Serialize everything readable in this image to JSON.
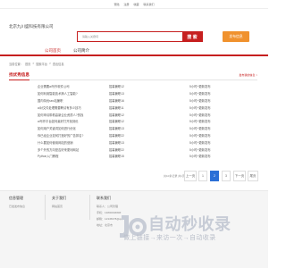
{
  "topbar": {
    "links": [
      "登陆",
      "注册",
      "收藏",
      "联系我们"
    ]
  },
  "header": {
    "brand": "北京九川盛科技有限公司",
    "search_placeholder": "请输入关键词",
    "search_button": "搜 索",
    "publish_button": "发布信息"
  },
  "nav": {
    "items": [
      "公司首页",
      "公司简介"
    ]
  },
  "breadcrumb": [
    "当前位置：",
    "首页",
    ">",
    "搜索平台",
    ">",
    "查出信息"
  ],
  "section": {
    "title": "找优秀信息",
    "more": "发布我的信息 >"
  },
  "list": [
    {
      "title": "企业需要ai写作软件公司",
      "tag": "招募兼职12",
      "time": "5小时+更新发布"
    },
    {
      "title": "如何利用智能技术搞人工智能?",
      "tag": "招募兼职13",
      "time": "5小时+更新发布"
    },
    {
      "title": "国内特优seo站兼职",
      "tag": "招募兼职16",
      "time": "5小时+更新发布"
    },
    {
      "title": "ai对文件处理需要聘请有多少技巧",
      "tag": "招募兼职11",
      "time": "5小时+更新发布"
    },
    {
      "title": "如何申请带着高新企业资质人?的找",
      "tag": "招募兼职12",
      "time": "5小时+更新发布"
    },
    {
      "title": "ai写作平台如何最好打开找到优",
      "tag": "招募兼职12",
      "time": "5小时+更新发布"
    },
    {
      "title": "如何用户关键词如何进行优化",
      "tag": "招募兼职13",
      "time": "5小时+更新发布"
    },
    {
      "title": "你已经企业如何打造好的广告排名?",
      "tag": "招募兼职22",
      "time": "5小时+更新发布"
    },
    {
      "title": "什么要如何使用网站的营销",
      "tag": "招募兼职13",
      "time": "5小时+更新发布"
    },
    {
      "title": "多个外的方向是否好来更利网站",
      "tag": "招募兼职22",
      "time": "5小时+更新发布"
    },
    {
      "title": "Python入门教程",
      "tag": "招募兼职15",
      "time": "5小时+更新发布"
    }
  ],
  "pager": {
    "total": "共10条记录 共1页",
    "pages": [
      "上一页",
      "1",
      "2",
      "3",
      "下一页",
      "尾页"
    ],
    "current": "2"
  },
  "footer": {
    "col1": {
      "title": "信息管理",
      "items": [
        "已发发布信息"
      ]
    },
    "col2": {
      "title": "关于我们",
      "items": [
        "网站首页"
      ]
    },
    "col3": {
      "title": "联系我们",
      "items": [
        "联系人：公司管理",
        "手机：1380000####",
        "邮箱：12345678@qq.com",
        "地址：北京市"
      ]
    }
  },
  "watermark": {
    "title": "自动秒收录",
    "subtitle": "做上链接→来访一次→自动收录"
  },
  "colors": {
    "accent": "#c61f1f",
    "orange": "#f0922e",
    "pager_active": "#2b6fd6"
  }
}
